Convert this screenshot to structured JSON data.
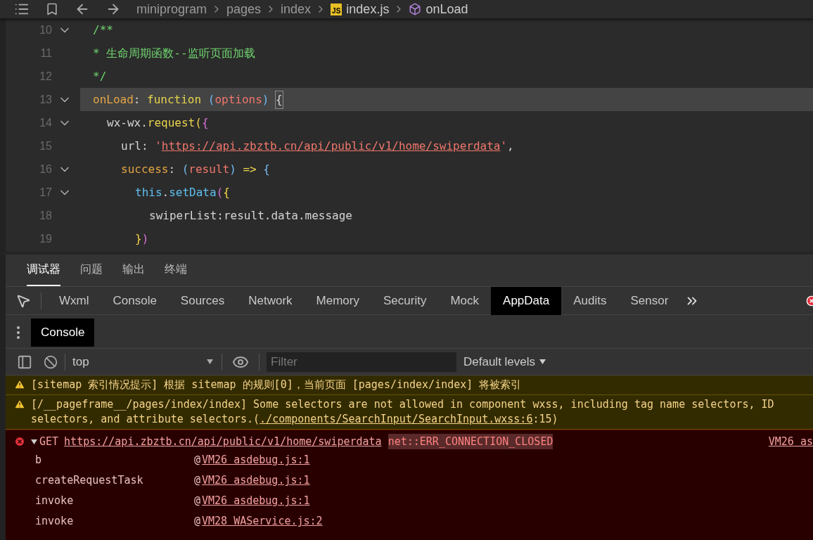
{
  "breadcrumb": {
    "items": [
      {
        "label": "miniprogram",
        "kind": "folder"
      },
      {
        "label": "pages",
        "kind": "folder"
      },
      {
        "label": "index",
        "kind": "folder"
      },
      {
        "label": "index.js",
        "kind": "js",
        "badge": "JS"
      },
      {
        "label": "onLoad",
        "kind": "symbol"
      }
    ]
  },
  "editor": {
    "lines": [
      {
        "number": "10",
        "foldable": true,
        "highlighted": false,
        "tokens": [
          {
            "t": "/**",
            "kind": "comment"
          }
        ]
      },
      {
        "number": "11",
        "foldable": false,
        "highlighted": false,
        "tokens": [
          {
            "t": "* 生命周期函数--监听页面加载",
            "kind": "comment"
          }
        ]
      },
      {
        "number": "12",
        "foldable": false,
        "highlighted": false,
        "tokens": [
          {
            "t": "*/",
            "kind": "comment"
          }
        ]
      },
      {
        "number": "13",
        "foldable": true,
        "highlighted": true,
        "tokens": [
          {
            "t": "onLoad",
            "kind": "prop"
          },
          {
            "t": ": ",
            "kind": "plain"
          },
          {
            "t": "function",
            "kind": "func"
          },
          {
            "t": " (",
            "kind": "punct"
          },
          {
            "t": "options",
            "kind": "param"
          },
          {
            "t": ") ",
            "kind": "punct"
          },
          {
            "t": "{",
            "kind": "cursor"
          }
        ],
        "children": [
          {
            "number": "14",
            "foldable": true,
            "highlighted": false,
            "tokens": [
              {
                "t": "wx-wx.",
                "kind": "plain"
              },
              {
                "t": "request",
                "kind": "func"
              },
              {
                "t": "(",
                "kind": "bracket"
              },
              {
                "t": "{",
                "kind": "bracket2"
              }
            ],
            "children": [
              {
                "number": "15",
                "foldable": false,
                "highlighted": false,
                "tokens": [
                  {
                    "t": "url: ",
                    "kind": "plain"
                  },
                  {
                    "t": "'",
                    "kind": "param"
                  },
                  {
                    "t": "https://api.zbztb.cn/api/public/v1/home/swiperdata",
                    "kind": "link"
                  },
                  {
                    "t": "'",
                    "kind": "param"
                  },
                  {
                    "t": ",",
                    "kind": "plain"
                  }
                ]
              },
              {
                "number": "16",
                "foldable": true,
                "highlighted": false,
                "tokens": [
                  {
                    "t": "success",
                    "kind": "prop"
                  },
                  {
                    "t": ": ",
                    "kind": "plain"
                  },
                  {
                    "t": "(",
                    "kind": "punct"
                  },
                  {
                    "t": "result",
                    "kind": "param"
                  },
                  {
                    "t": ")",
                    "kind": "punct"
                  },
                  {
                    "t": " => ",
                    "kind": "func"
                  },
                  {
                    "t": "{",
                    "kind": "punct"
                  }
                ],
                "children": [
                  {
                    "number": "17",
                    "foldable": true,
                    "highlighted": false,
                    "tokens": [
                      {
                        "t": "this",
                        "kind": "keyword"
                      },
                      {
                        "t": ".",
                        "kind": "plain"
                      },
                      {
                        "t": "setData",
                        "kind": "keyword"
                      },
                      {
                        "t": "(",
                        "kind": "bracket2"
                      },
                      {
                        "t": "{",
                        "kind": "bracket"
                      }
                    ],
                    "children": [
                      {
                        "number": "18",
                        "foldable": false,
                        "highlighted": false,
                        "tokens": [
                          {
                            "t": "swiperList:result.data.message",
                            "kind": "plain"
                          }
                        ]
                      }
                    ]
                  },
                  {
                    "number": "19",
                    "foldable": false,
                    "highlighted": false,
                    "tokens": [
                      {
                        "t": "}",
                        "kind": "bracket"
                      },
                      {
                        "t": ")",
                        "kind": "bracket2"
                      }
                    ]
                  }
                ]
              }
            ]
          }
        ]
      }
    ]
  },
  "panel_tabs": [
    {
      "label": "调试器",
      "selected": true
    },
    {
      "label": "问题",
      "selected": false
    },
    {
      "label": "输出",
      "selected": false
    },
    {
      "label": "终端",
      "selected": false
    }
  ],
  "devtools_tabs": [
    {
      "label": "Wxml",
      "selected": false
    },
    {
      "label": "Console",
      "selected": false
    },
    {
      "label": "Sources",
      "selected": false
    },
    {
      "label": "Network",
      "selected": false
    },
    {
      "label": "Memory",
      "selected": false
    },
    {
      "label": "Security",
      "selected": false
    },
    {
      "label": "Mock",
      "selected": false
    },
    {
      "label": "AppData",
      "selected": true
    },
    {
      "label": "Audits",
      "selected": false
    },
    {
      "label": "Sensor",
      "selected": false
    }
  ],
  "drawer_tab": {
    "label": "Console",
    "selected": true
  },
  "console_toolbar": {
    "context": "top",
    "filter_placeholder": "Filter",
    "levels": "Default levels"
  },
  "messages": [
    {
      "kind": "warning",
      "parts": [
        {
          "t": "[sitemap 索引情况提示] 根据 sitemap 的规则[0]，当前页面 [pages/index/index] 将被索引",
          "kind": "text"
        }
      ]
    },
    {
      "kind": "warning",
      "parts": [
        {
          "t": "[/__pageframe__/pages/index/index] Some selectors are not allowed in component wxss, including tag name selectors, ID selectors, and attribute selectors.(",
          "kind": "text"
        },
        {
          "t": "./components/SearchInput/SearchInput.wxss:6",
          "kind": "link"
        },
        {
          "t": ":15)",
          "kind": "text"
        }
      ]
    },
    {
      "kind": "error",
      "expanded": true,
      "method": "GET",
      "parts": [
        {
          "t": "https://api.zbztb.cn/api/public/v1/home/swiperdata",
          "kind": "link"
        },
        {
          "t": "net::ERR_CONNECTION_CLOSED",
          "kind": "code"
        }
      ],
      "source": "VM26 as",
      "stack": [
        {
          "fn": "b",
          "at": "@",
          "src": "VM26 asdebug.js:1"
        },
        {
          "fn": "createRequestTask",
          "at": "@",
          "src": "VM26 asdebug.js:1"
        },
        {
          "fn": "invoke",
          "at": "@",
          "src": "VM26 asdebug.js:1"
        },
        {
          "fn": "invoke",
          "at": "@",
          "src": "VM28 WAService.js:2"
        }
      ]
    }
  ]
}
